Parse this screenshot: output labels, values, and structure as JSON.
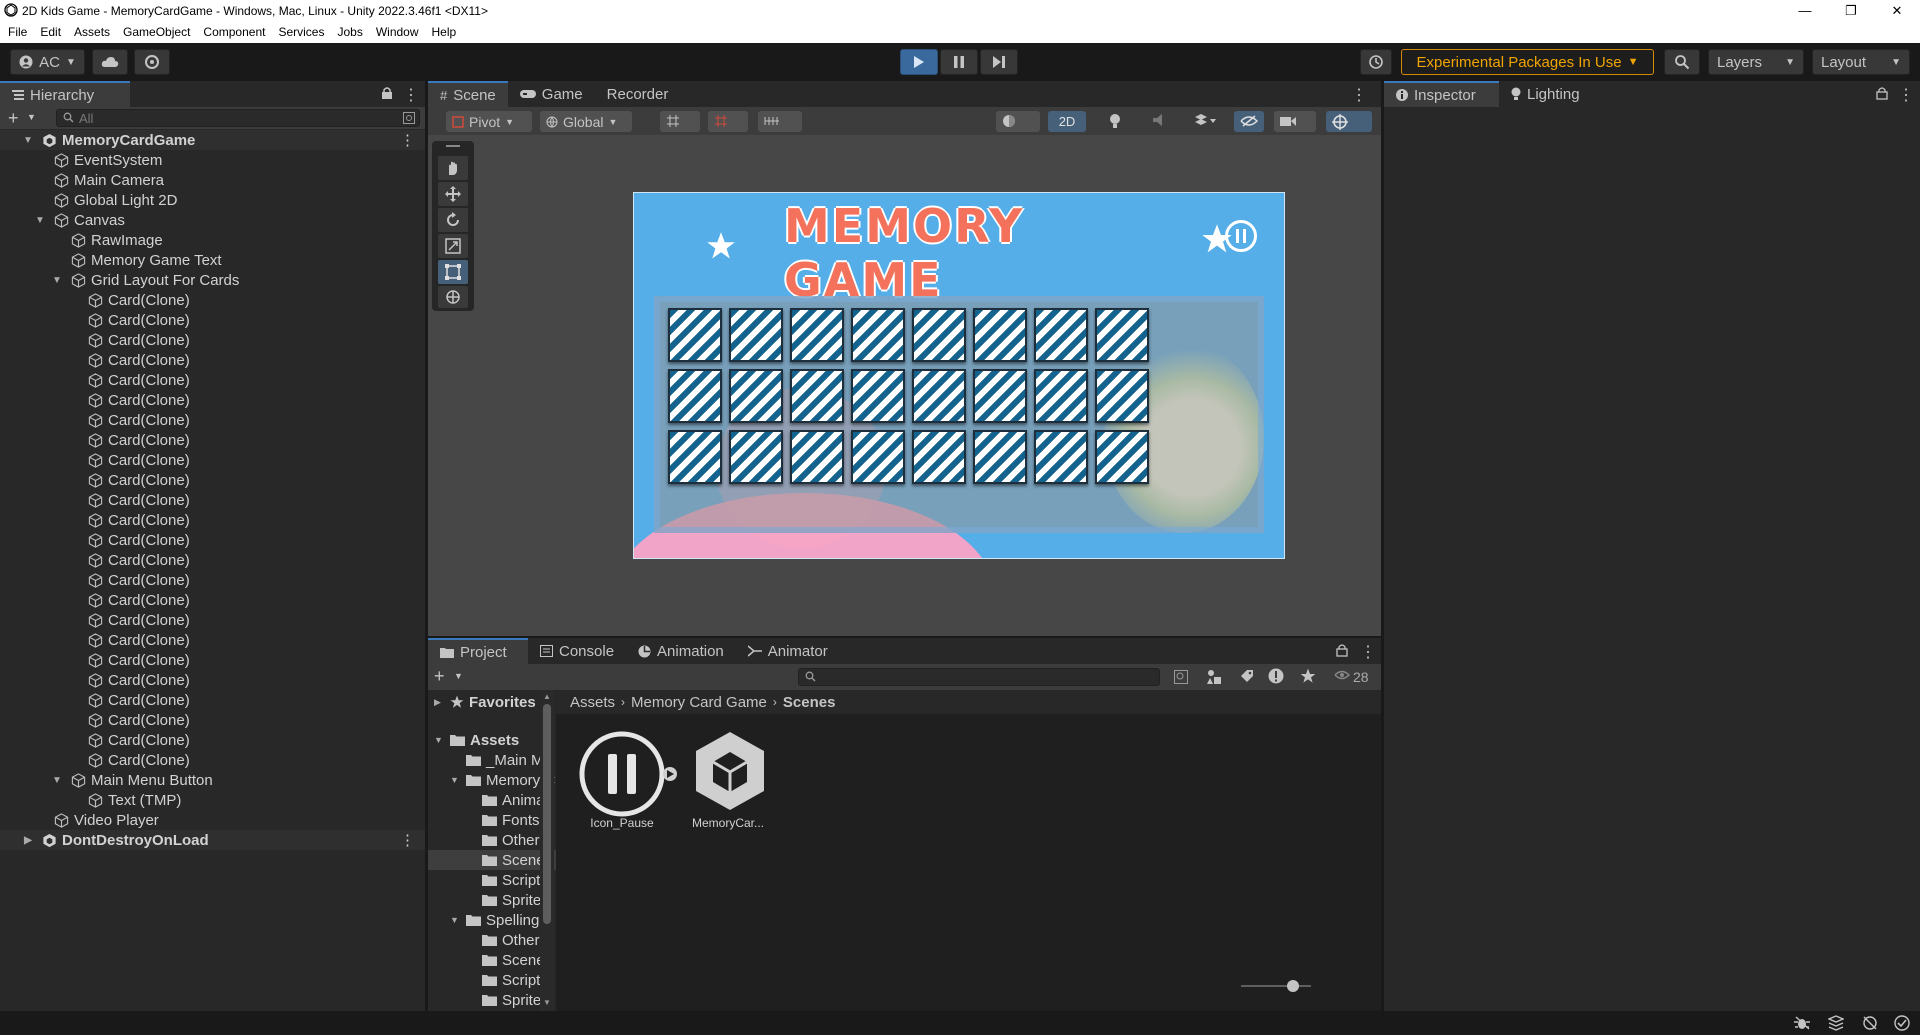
{
  "window": {
    "title": "2D Kids Game - MemoryCardGame - Windows, Mac, Linux - Unity 2022.3.46f1 <DX11>"
  },
  "menu": [
    "File",
    "Edit",
    "Assets",
    "GameObject",
    "Component",
    "Services",
    "Jobs",
    "Window",
    "Help"
  ],
  "toolbar": {
    "account": "AC",
    "experimental": "Experimental Packages In Use",
    "layers": "Layers",
    "layout": "Layout"
  },
  "hierarchy": {
    "tab": "Hierarchy",
    "search_placeholder": "All",
    "rows": [
      {
        "label": "MemoryCardGame",
        "depth": 0,
        "root": true,
        "arrow": "open"
      },
      {
        "label": "EventSystem",
        "depth": 1
      },
      {
        "label": "Main Camera",
        "depth": 1
      },
      {
        "label": "Global Light 2D",
        "depth": 1
      },
      {
        "label": "Canvas",
        "depth": 1,
        "arrow": "open"
      },
      {
        "label": "RawImage",
        "depth": 2
      },
      {
        "label": "Memory Game Text",
        "depth": 2
      },
      {
        "label": "Grid Layout For Cards",
        "depth": 2,
        "arrow": "open"
      },
      {
        "label": "Card(Clone)",
        "depth": 3
      },
      {
        "label": "Card(Clone)",
        "depth": 3
      },
      {
        "label": "Card(Clone)",
        "depth": 3
      },
      {
        "label": "Card(Clone)",
        "depth": 3
      },
      {
        "label": "Card(Clone)",
        "depth": 3
      },
      {
        "label": "Card(Clone)",
        "depth": 3
      },
      {
        "label": "Card(Clone)",
        "depth": 3
      },
      {
        "label": "Card(Clone)",
        "depth": 3
      },
      {
        "label": "Card(Clone)",
        "depth": 3
      },
      {
        "label": "Card(Clone)",
        "depth": 3
      },
      {
        "label": "Card(Clone)",
        "depth": 3
      },
      {
        "label": "Card(Clone)",
        "depth": 3
      },
      {
        "label": "Card(Clone)",
        "depth": 3
      },
      {
        "label": "Card(Clone)",
        "depth": 3
      },
      {
        "label": "Card(Clone)",
        "depth": 3
      },
      {
        "label": "Card(Clone)",
        "depth": 3
      },
      {
        "label": "Card(Clone)",
        "depth": 3
      },
      {
        "label": "Card(Clone)",
        "depth": 3
      },
      {
        "label": "Card(Clone)",
        "depth": 3
      },
      {
        "label": "Card(Clone)",
        "depth": 3
      },
      {
        "label": "Card(Clone)",
        "depth": 3
      },
      {
        "label": "Card(Clone)",
        "depth": 3
      },
      {
        "label": "Card(Clone)",
        "depth": 3
      },
      {
        "label": "Card(Clone)",
        "depth": 3
      },
      {
        "label": "Main Menu Button",
        "depth": 2,
        "arrow": "open"
      },
      {
        "label": "Text (TMP)",
        "depth": 3
      },
      {
        "label": "Video Player",
        "depth": 1
      },
      {
        "label": "DontDestroyOnLoad",
        "depth": 0,
        "root": true,
        "arrow": "closed"
      }
    ]
  },
  "scene": {
    "tabs": [
      "Scene",
      "Game",
      "Recorder"
    ],
    "pivot": "Pivot",
    "global": "Global",
    "mode2d": "2D",
    "game_title": "MEMORY GAME"
  },
  "inspector": {
    "tabs": [
      "Inspector",
      "Lighting"
    ]
  },
  "project": {
    "tabs": [
      "Project",
      "Console",
      "Animation",
      "Animator"
    ],
    "count": "28",
    "breadcrumb": [
      "Assets",
      "Memory Card Game",
      "Scenes"
    ],
    "tree": [
      {
        "label": "Favorites",
        "depth": 0,
        "bold": true,
        "arrow": "closed",
        "star": true
      },
      {
        "label": "Assets",
        "depth": 0,
        "bold": true,
        "arrow": "open",
        "folder": true
      },
      {
        "label": "_Main Me",
        "depth": 1,
        "folder": true
      },
      {
        "label": "Memory C",
        "depth": 1,
        "folder": true,
        "arrow": "open"
      },
      {
        "label": "Animati",
        "depth": 2,
        "folder": true
      },
      {
        "label": "Fonts",
        "depth": 2,
        "folder": true
      },
      {
        "label": "Other",
        "depth": 2,
        "folder": true
      },
      {
        "label": "Scenes",
        "depth": 2,
        "folder": true,
        "selected": true
      },
      {
        "label": "Scripts",
        "depth": 2,
        "folder": true
      },
      {
        "label": "Sprites",
        "depth": 2,
        "folder": true
      },
      {
        "label": "Spelling C",
        "depth": 1,
        "folder": true,
        "arrow": "open"
      },
      {
        "label": "Other",
        "depth": 2,
        "folder": true
      },
      {
        "label": "Scenes",
        "depth": 2,
        "folder": true
      },
      {
        "label": "Scripts",
        "depth": 2,
        "folder": true
      },
      {
        "label": "Sprites",
        "depth": 2,
        "folder": true
      }
    ],
    "assets": [
      {
        "label": "Icon_Pause"
      },
      {
        "label": "MemoryCar..."
      }
    ]
  }
}
